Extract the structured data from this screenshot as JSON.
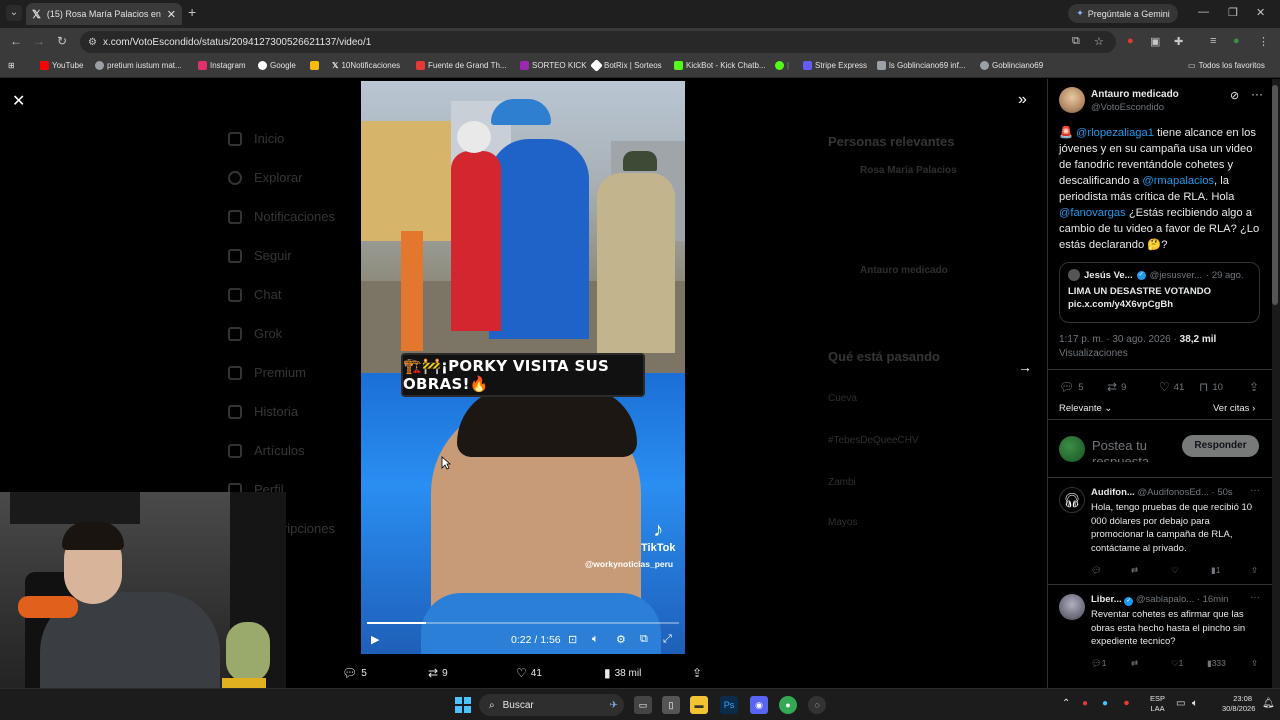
{
  "browser": {
    "tab_title": "(15) Rosa María Palacios en X: \"",
    "gemini_label": "Pregúntale a Gemini",
    "url": "x.com/VotoEscondido/status/2094127300526621137/video/1",
    "bookmarks": [
      {
        "label": "YouTube",
        "color": "#ff0000"
      },
      {
        "label": "pretium iustum mat...",
        "color": "#9aa0a6"
      },
      {
        "label": "Instagram",
        "color": "#e1306c"
      },
      {
        "label": "Google",
        "color": "#4285f4"
      },
      {
        "label": "",
        "color": "#fbbc05"
      },
      {
        "label": "10Notificaciones",
        "color": "#ffffff"
      },
      {
        "label": "Fuente de Grand Th...",
        "color": "#e53935"
      },
      {
        "label": "SORTEO KICK",
        "color": "#9c27b0"
      },
      {
        "label": "BotRix | Sorteos",
        "color": "#ffffff"
      },
      {
        "label": "KickBot - Kick Chatb...",
        "color": "#53fc18"
      },
      {
        "label": "",
        "color": "#53fc18"
      },
      {
        "label": "Stripe Express",
        "color": "#635bff"
      },
      {
        "label": "ls Goblinciano69 inf...",
        "color": "#9aa0a6"
      },
      {
        "label": "Goblinciano69",
        "color": "#9aa0a6"
      }
    ],
    "all_favorites": "Todos los favoritos"
  },
  "background_page": {
    "nav": [
      "Inicio",
      "Explorar",
      "Notificaciones",
      "Seguir",
      "Chat",
      "Grok",
      "Premium",
      "Historia",
      "Artículos",
      "Perfil",
      "Suscripciones"
    ],
    "sidebar_relevant": "Personas relevantes",
    "sidebar_trending": "Qué está pasando",
    "relevant_people": [
      "Rosa María Palacios",
      "Antauro medicado"
    ],
    "trends": [
      "Cueva",
      "#TebesDeQueeCHV",
      "Zambi",
      "Mayos"
    ]
  },
  "video": {
    "caption": "🏗️🚧¡PORKY VISITA SUS OBRAS!🔥",
    "tiktok_label": "TikTok",
    "tiktok_handle": "@workynoticias_peru",
    "time": "0:22 / 1:56",
    "progress": 0.19
  },
  "video_engagement": {
    "replies": "5",
    "reposts": "9",
    "likes": "41",
    "views": "38 mil"
  },
  "tweet": {
    "author_name": "Antauro medicado",
    "author_handle": "@VotoEscondido",
    "text_parts": {
      "emoji": "🚨",
      "mention1": "@rlopezaliaga1",
      "p1": " tiene alcance en los jóvenes y en su campaña usa un video de fanodric reventándole cohetes y descalificando a ",
      "mention2": "@rmapalacios",
      "p2": ", la periodista más crítica de RLA. Hola ",
      "mention3": "@fanovargas",
      "p3": " ¿Estás recibiendo algo a cambio de tu video a favor de RLA? ¿Lo estás declarando 🤔?"
    },
    "quote": {
      "name": "Jesús Ve...",
      "handle": "@jesusver...",
      "date": "· 29 ago.",
      "line1": "LIMA UN DESASTRE VOTANDO",
      "line2": "pic.x.com/y4X6vpCgBh"
    },
    "timestamp": "1:17 p. m. · 30 ago. 2026 · ",
    "views_count": "38,2 mil",
    "views_label": "Visualizaciones",
    "stats": {
      "replies": "5",
      "reposts": "9",
      "likes": "41",
      "bookmarks": "10"
    },
    "sort_label": "Relevante",
    "quotes_label": "Ver citas",
    "reply_placeholder": "Postea tu respuesta",
    "reply_button": "Responder"
  },
  "replies": [
    {
      "name": "Audifon...",
      "handle": "@AudifonosEd...",
      "time": "· 50s",
      "text": "Hola, tengo pruebas de que recibió 10 000 dólares por debajo para promocionar la campaña de RLA, contáctame al privado.",
      "views": "1",
      "likes": ""
    },
    {
      "name": "Liber...",
      "handle": "@sablapalo...",
      "time": "· 16min",
      "text": "Reventar cohetes es afirmar que las obras esta hecho hasta el pincho sin expediente tecnico?",
      "replies": "1",
      "likes": "1",
      "views": "333"
    }
  ],
  "taskbar": {
    "search_label": "Buscar",
    "lang_line1": "ESP",
    "lang_line2": "LAA",
    "time": "23:08",
    "date": "30/8/2026",
    "badge": "99+"
  }
}
